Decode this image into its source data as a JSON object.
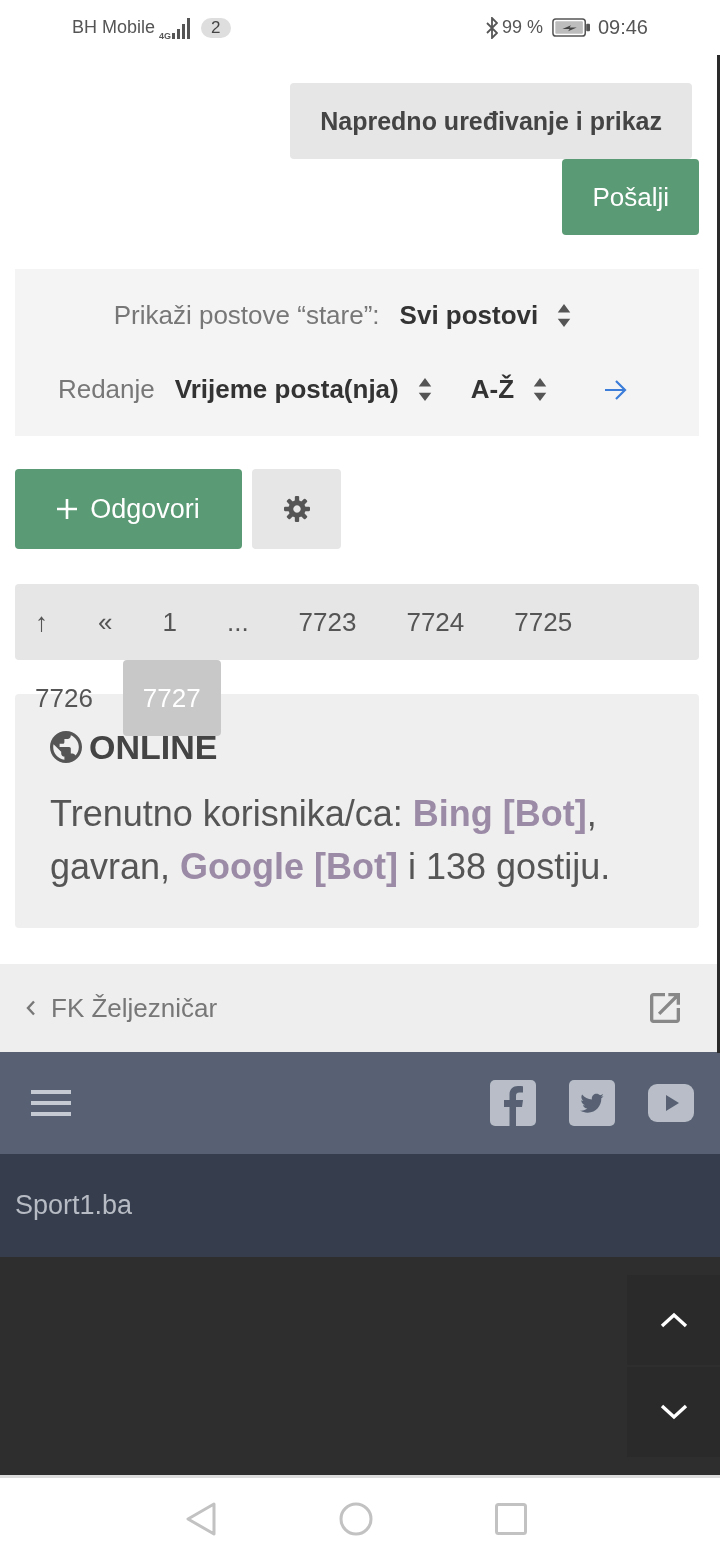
{
  "status_bar": {
    "carrier": "BH Mobile",
    "network_type": "4G",
    "badge": "2",
    "battery": "99 %",
    "time": "09:46"
  },
  "editor": {
    "buttons": [
      {
        "label": "Napredno uređivanje i prikaz",
        "kind": "secondary"
      },
      {
        "label": "Pošalji",
        "kind": "primary"
      }
    ]
  },
  "filters": {
    "age": {
      "label": "Prikaži postove “stare”:",
      "value": "Svi postovi"
    },
    "sort": {
      "label": "Redanje",
      "key": "Vrijeme posta(nja)",
      "direction": "A-Ž"
    }
  },
  "actions": {
    "reply": "Odgovori"
  },
  "pagination": [
    {
      "label": "↑",
      "selected": false
    },
    {
      "label": "«",
      "selected": false
    },
    {
      "label": "1",
      "selected": false
    },
    {
      "label": "...",
      "selected": false
    },
    {
      "label": "7723",
      "selected": false
    },
    {
      "label": "7724",
      "selected": false
    },
    {
      "label": "7725",
      "selected": false
    },
    {
      "label": "7726",
      "selected": false
    },
    {
      "label": "7727",
      "selected": true
    }
  ],
  "online": {
    "title": "ONLINE",
    "segments": [
      {
        "kind": "text",
        "text": "Trenutno korisnika/ca: "
      },
      {
        "kind": "user",
        "text": "Bing [Bot]",
        "color": "#9c8ba7"
      },
      {
        "kind": "text",
        "text": ", gavran, "
      },
      {
        "kind": "user",
        "text": "Google [Bot]",
        "color": "#9c8ba7"
      },
      {
        "kind": "text",
        "text": " i 138 gostiju."
      }
    ]
  },
  "breadcrumb": {
    "label": "FK Željezničar"
  },
  "footer": {
    "site": "Sport1.ba"
  }
}
